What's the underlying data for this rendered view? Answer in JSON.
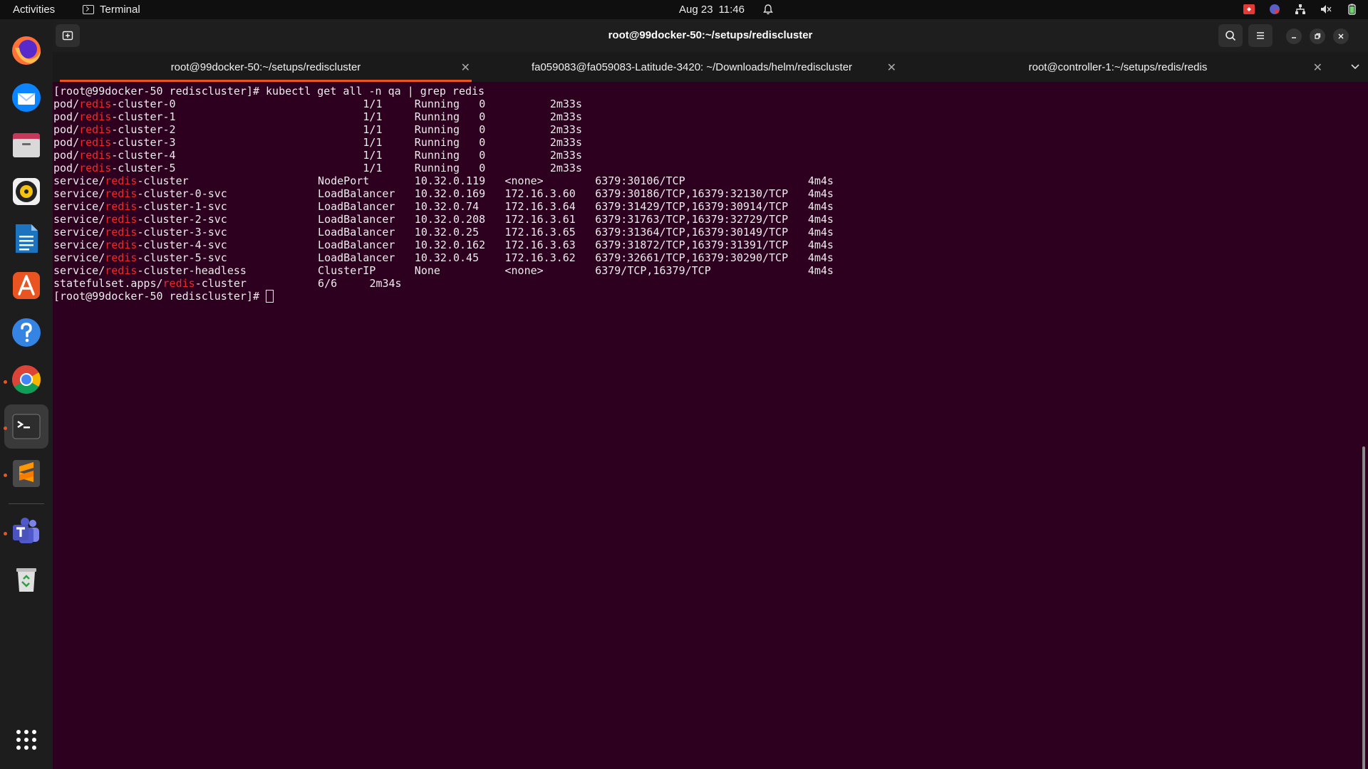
{
  "topbar": {
    "activities": "Activities",
    "app_name": "Terminal",
    "date": "Aug 23",
    "time": "11:46"
  },
  "window": {
    "title": "root@99docker-50:~/setups/rediscluster"
  },
  "tabs": [
    {
      "label": "root@99docker-50:~/setups/rediscluster",
      "active": true
    },
    {
      "label": "fa059083@fa059083-Latitude-3420: ~/Downloads/helm/rediscluster",
      "active": false
    },
    {
      "label": "root@controller-1:~/setups/redis/redis",
      "active": false
    }
  ],
  "terminal": {
    "command_line": "[root@99docker-50 rediscluster]# kubectl get all -n qa | grep redis",
    "highlight": "redis",
    "pods": [
      {
        "prefix": "pod/",
        "suffix": "-cluster-0",
        "ready": "1/1",
        "status": "Running",
        "restarts": "0",
        "age": "2m33s"
      },
      {
        "prefix": "pod/",
        "suffix": "-cluster-1",
        "ready": "1/1",
        "status": "Running",
        "restarts": "0",
        "age": "2m33s"
      },
      {
        "prefix": "pod/",
        "suffix": "-cluster-2",
        "ready": "1/1",
        "status": "Running",
        "restarts": "0",
        "age": "2m33s"
      },
      {
        "prefix": "pod/",
        "suffix": "-cluster-3",
        "ready": "1/1",
        "status": "Running",
        "restarts": "0",
        "age": "2m33s"
      },
      {
        "prefix": "pod/",
        "suffix": "-cluster-4",
        "ready": "1/1",
        "status": "Running",
        "restarts": "0",
        "age": "2m33s"
      },
      {
        "prefix": "pod/",
        "suffix": "-cluster-5",
        "ready": "1/1",
        "status": "Running",
        "restarts": "0",
        "age": "2m33s"
      }
    ],
    "services": [
      {
        "prefix": "service/",
        "suffix": "-cluster",
        "type": "NodePort",
        "cluster_ip": "10.32.0.119",
        "external_ip": "<none>",
        "ports": "6379:30106/TCP",
        "age": "4m4s"
      },
      {
        "prefix": "service/",
        "suffix": "-cluster-0-svc",
        "type": "LoadBalancer",
        "cluster_ip": "10.32.0.169",
        "external_ip": "172.16.3.60",
        "ports": "6379:30186/TCP,16379:32130/TCP",
        "age": "4m4s"
      },
      {
        "prefix": "service/",
        "suffix": "-cluster-1-svc",
        "type": "LoadBalancer",
        "cluster_ip": "10.32.0.74",
        "external_ip": "172.16.3.64",
        "ports": "6379:31429/TCP,16379:30914/TCP",
        "age": "4m4s"
      },
      {
        "prefix": "service/",
        "suffix": "-cluster-2-svc",
        "type": "LoadBalancer",
        "cluster_ip": "10.32.0.208",
        "external_ip": "172.16.3.61",
        "ports": "6379:31763/TCP,16379:32729/TCP",
        "age": "4m4s"
      },
      {
        "prefix": "service/",
        "suffix": "-cluster-3-svc",
        "type": "LoadBalancer",
        "cluster_ip": "10.32.0.25",
        "external_ip": "172.16.3.65",
        "ports": "6379:31364/TCP,16379:30149/TCP",
        "age": "4m4s"
      },
      {
        "prefix": "service/",
        "suffix": "-cluster-4-svc",
        "type": "LoadBalancer",
        "cluster_ip": "10.32.0.162",
        "external_ip": "172.16.3.63",
        "ports": "6379:31872/TCP,16379:31391/TCP",
        "age": "4m4s"
      },
      {
        "prefix": "service/",
        "suffix": "-cluster-5-svc",
        "type": "LoadBalancer",
        "cluster_ip": "10.32.0.45",
        "external_ip": "172.16.3.62",
        "ports": "6379:32661/TCP,16379:30290/TCP",
        "age": "4m4s"
      },
      {
        "prefix": "service/",
        "suffix": "-cluster-headless",
        "type": "ClusterIP",
        "cluster_ip": "None",
        "external_ip": "<none>",
        "ports": "6379/TCP,16379/TCP",
        "age": "4m4s"
      }
    ],
    "statefulset": {
      "prefix": "statefulset.apps/",
      "suffix": "-cluster",
      "ready": "6/6",
      "age": "2m34s"
    },
    "prompt": "[root@99docker-50 rediscluster]# "
  },
  "dock": [
    {
      "name": "firefox-icon"
    },
    {
      "name": "thunderbird-icon"
    },
    {
      "name": "files-icon"
    },
    {
      "name": "rhythmbox-icon"
    },
    {
      "name": "writer-icon"
    },
    {
      "name": "app-center-icon"
    },
    {
      "name": "help-icon"
    },
    {
      "name": "chrome-icon"
    },
    {
      "name": "terminal-icon"
    },
    {
      "name": "sublime-icon"
    },
    {
      "name": "teams-icon"
    },
    {
      "name": "trash-icon"
    },
    {
      "name": "app-grid-icon"
    }
  ],
  "colors": {
    "terminal_bg": "#2c001e",
    "highlight": "#ef2929",
    "accent": "#e95420"
  }
}
